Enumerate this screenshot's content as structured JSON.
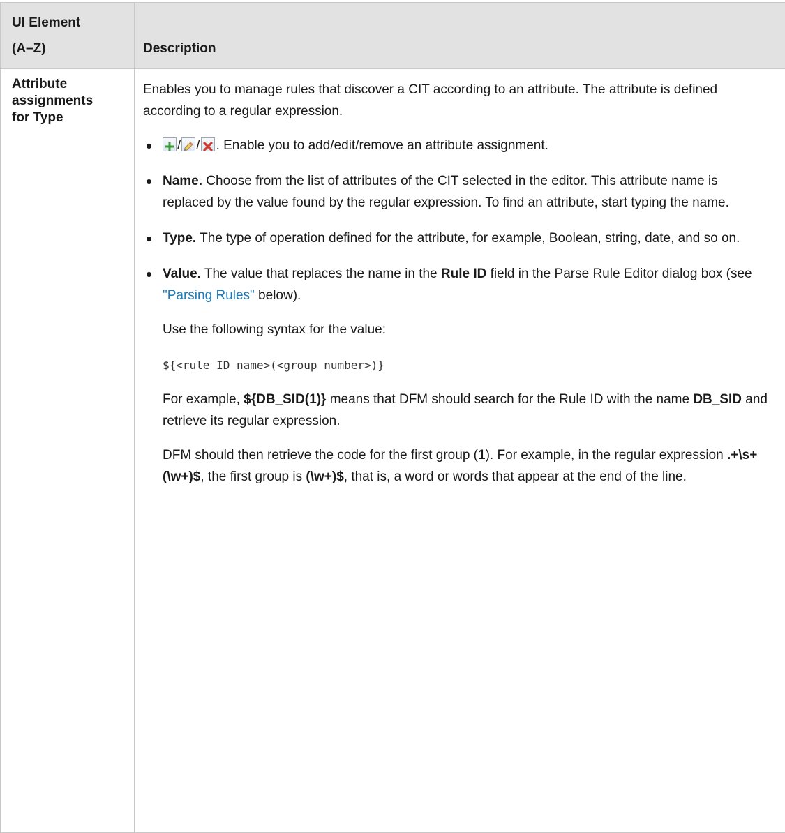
{
  "table": {
    "header": {
      "col1": "UI Element",
      "col1_sub": "(A–Z)",
      "col2": "Description"
    },
    "row": {
      "element_lines": [
        "Attribute",
        "assignments",
        "for Type"
      ],
      "intro": "Enables you to manage rules that discover a CIT according to an attribute. The attribute is defined according to a regular expression.",
      "icons": {
        "add": "add-icon",
        "edit": "edit-pencil-icon",
        "remove": "remove-x-icon",
        "slash": "/"
      },
      "icons_text": ". Enable you to add/edit/remove an attribute assignment.",
      "name_label": "Name.",
      "name_text": " Choose from the list of attributes of the CIT selected in the editor. This attribute name is replaced by the value found by the regular expression. To find an attribute, start typing the name.",
      "type_label": "Type.",
      "type_text": " The type of operation defined for the attribute, for example, Boolean, string, date, and so on.",
      "value_label": "Value.",
      "value_text_1": " The value that replaces the name in the ",
      "value_rule_id": "Rule ID",
      "value_text_2": " field in the Parse Rule Editor dialog box (see ",
      "value_link": "\"Parsing Rules\"",
      "value_text_3": " below).",
      "syntax_intro": "Use the following syntax for the value:",
      "syntax_code": "${<rule ID name>(<group number>)}",
      "example_1": "For example, ",
      "example_bold_1": "${DB_SID(1)}",
      "example_2": " means that DFM should search for the Rule ID with the name ",
      "example_bold_2": "DB_SID",
      "example_3": " and retrieve its regular expression.",
      "group_1": "DFM should then retrieve the code for the first group (",
      "group_bold_1": "1",
      "group_2": "). For example, in the regular expression ",
      "group_bold_2": ".+\\s+(\\w+)$",
      "group_3": ", the first group is ",
      "group_bold_3": "(\\w+)$",
      "group_4": ", that is, a word or words that appear at the end of the line."
    }
  },
  "colors": {
    "header_bg": "#e2e2e2",
    "border": "#c8c8c8",
    "link": "#1f7bb8",
    "add_icon": "#3a9a3a",
    "remove_icon": "#d03a2a"
  }
}
